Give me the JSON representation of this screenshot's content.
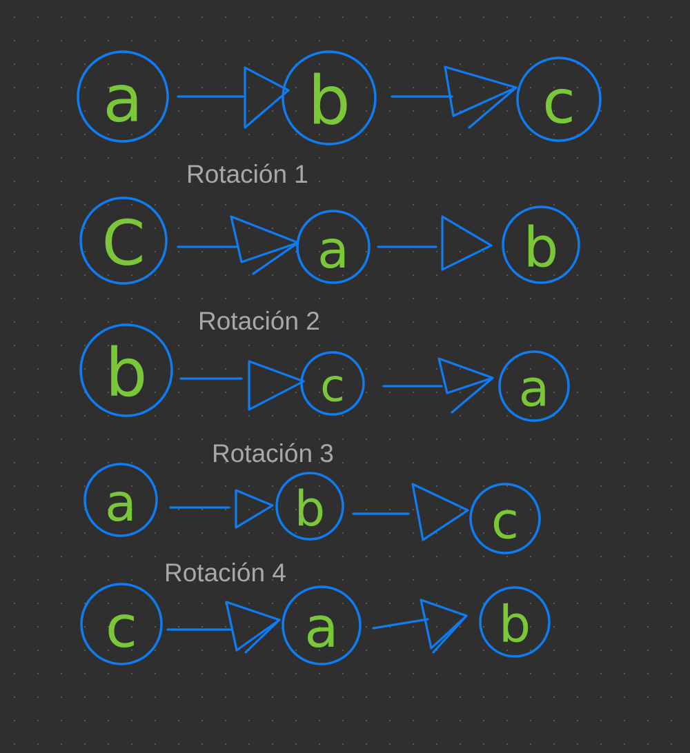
{
  "colors": {
    "background": "#2f2f2f",
    "node_stroke": "#0f7cf2",
    "letter_fill": "#7ac83a",
    "label_color": "#a8a8a8"
  },
  "rows": [
    {
      "label": "",
      "nodes": [
        "a",
        "b",
        "c"
      ]
    },
    {
      "label": "Rotación 1",
      "nodes": [
        "C",
        "a",
        "b"
      ]
    },
    {
      "label": "Rotación 2",
      "nodes": [
        "b",
        "c",
        "a"
      ]
    },
    {
      "label": "Rotación 3",
      "nodes": [
        "a",
        "b",
        "c"
      ]
    },
    {
      "label": "Rotación 4",
      "nodes": [
        "c",
        "a",
        "b"
      ]
    }
  ]
}
